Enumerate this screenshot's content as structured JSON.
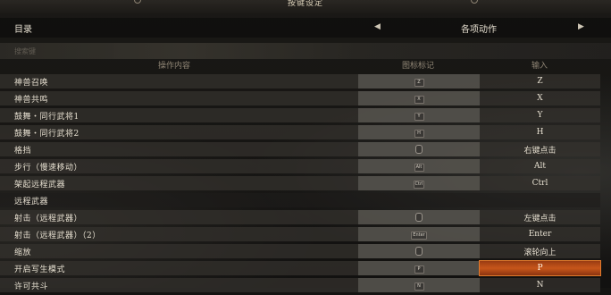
{
  "window": {
    "title": "按键设定"
  },
  "topbar": {
    "menu_label": "目录",
    "left_arrow_icon": "triangle-left-icon",
    "category": "各项动作",
    "right_arrow_icon": "triangle-right-icon"
  },
  "search": {
    "placeholder": "搜索键"
  },
  "columns": {
    "action": "操作内容",
    "icon": "图标标记",
    "input": "输入"
  },
  "rows": [
    {
      "action": "神兽召唤",
      "icon": "Z",
      "icon_type": "keycap",
      "key": "Z"
    },
    {
      "action": "神兽共鸣",
      "icon": "X",
      "icon_type": "keycap",
      "key": "X"
    },
    {
      "action": "鼓舞・同行武将1",
      "icon": "Y",
      "icon_type": "keycap",
      "key": "Y"
    },
    {
      "action": "鼓舞・同行武将2",
      "icon": "H",
      "icon_type": "keycap",
      "key": "H"
    },
    {
      "action": "格挡",
      "icon": "mouse-right-icon",
      "icon_type": "mouse",
      "key": "右键点击"
    },
    {
      "action": "步行（慢速移动）",
      "icon": "Alt",
      "icon_type": "keycap",
      "key": "Alt"
    },
    {
      "action": "架起远程武器",
      "icon": "Ctrl",
      "icon_type": "keycap",
      "key": "Ctrl"
    },
    {
      "section": "远程武器"
    },
    {
      "action": "射击（远程武器）",
      "icon": "mouse-left-icon",
      "icon_type": "mouse",
      "key": "左键点击"
    },
    {
      "action": "射击（远程武器）（2）",
      "icon": "Enter",
      "icon_type": "keycap",
      "key": "Enter"
    },
    {
      "action": "缩放",
      "icon": "mouse-wheel-icon",
      "icon_type": "mouse",
      "key": "滚轮向上"
    },
    {
      "action": "开启写生模式",
      "icon": "P",
      "icon_type": "keycap",
      "key": "P",
      "selected": true
    },
    {
      "action": "许可共斗",
      "icon": "N",
      "icon_type": "keycap",
      "key": "N"
    }
  ],
  "colors": {
    "selected_accent": "#c7561a",
    "row_bg": "#34322e",
    "icon_col_bg": "#54514c"
  }
}
